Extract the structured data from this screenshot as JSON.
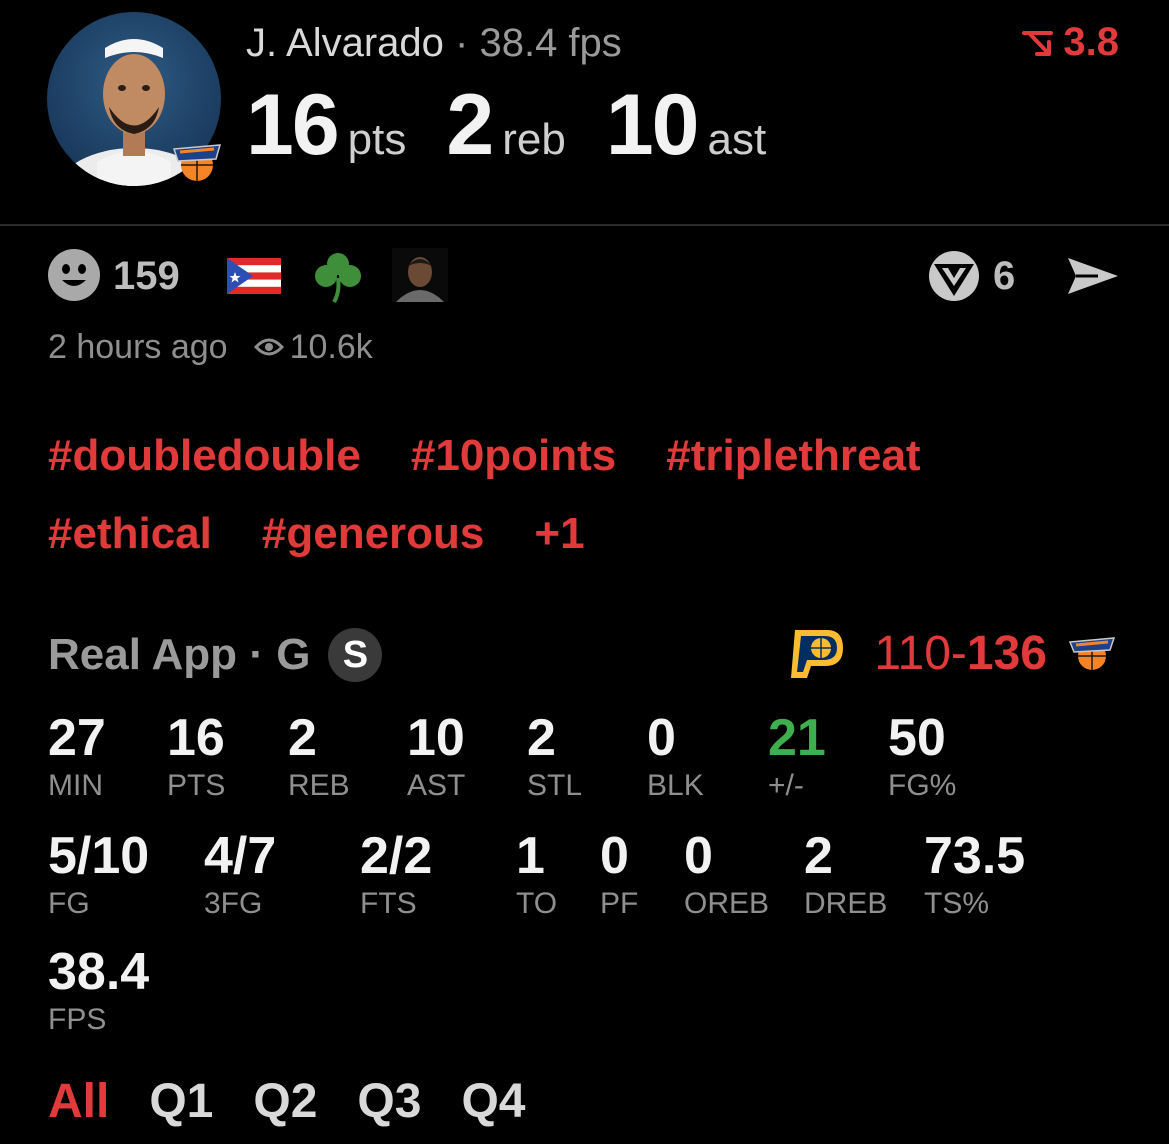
{
  "player": {
    "name": "J. Alvarado",
    "separator": "·",
    "fps_text": "38.4 fps",
    "pts": "16",
    "pts_unit": "pts",
    "reb": "2",
    "reb_unit": "reb",
    "ast": "10",
    "ast_unit": "ast",
    "trend_value": "3.8",
    "trend_icon": "down-trend-icon",
    "team_logo": "knicks-logo"
  },
  "social": {
    "reaction_icon": "smiley-icon",
    "reaction_count": "159",
    "emojis": [
      "puerto-rico-flag",
      "shamrock",
      "face-avatar"
    ],
    "vote_icon": "ballot-icon",
    "vote_count": "6",
    "share_icon": "send-icon",
    "time_ago": "2 hours ago",
    "views_icon": "eye-icon",
    "views": "10.6k"
  },
  "hashtags": {
    "row1": [
      "#doubledouble",
      "#10points",
      "#triplethreat"
    ],
    "row2": [
      "#ethical",
      "#generous",
      "+1"
    ]
  },
  "game": {
    "source": "Real App",
    "dot": "·",
    "position": "G",
    "badge": "S",
    "away_logo": "pacers-logo",
    "away_score": "110",
    "dash": "-",
    "home_score": "136",
    "home_logo": "knicks-logo"
  },
  "stats": [
    {
      "value": "27",
      "label": "MIN"
    },
    {
      "value": "16",
      "label": "PTS"
    },
    {
      "value": "2",
      "label": "REB"
    },
    {
      "value": "10",
      "label": "AST"
    },
    {
      "value": "2",
      "label": "STL"
    },
    {
      "value": "0",
      "label": "BLK"
    },
    {
      "value": "21",
      "label": "+/-"
    },
    {
      "value": "50",
      "label": "FG%"
    },
    {
      "value": "5/10",
      "label": "FG"
    },
    {
      "value": "4/7",
      "label": "3FG"
    },
    {
      "value": "2/2",
      "label": "FTS"
    },
    {
      "value": "1",
      "label": "TO"
    },
    {
      "value": "0",
      "label": "PF"
    },
    {
      "value": "0",
      "label": "OREB"
    },
    {
      "value": "2",
      "label": "DREB"
    },
    {
      "value": "73.5",
      "label": "TS%"
    },
    {
      "value": "38.4",
      "label": "FPS"
    }
  ],
  "tabs": [
    "All",
    "Q1",
    "Q2",
    "Q3",
    "Q4"
  ],
  "colors": {
    "accent_red": "#e03a3a",
    "positive_green": "#3fae4f",
    "muted": "#8f8f8f",
    "background": "#000000"
  }
}
